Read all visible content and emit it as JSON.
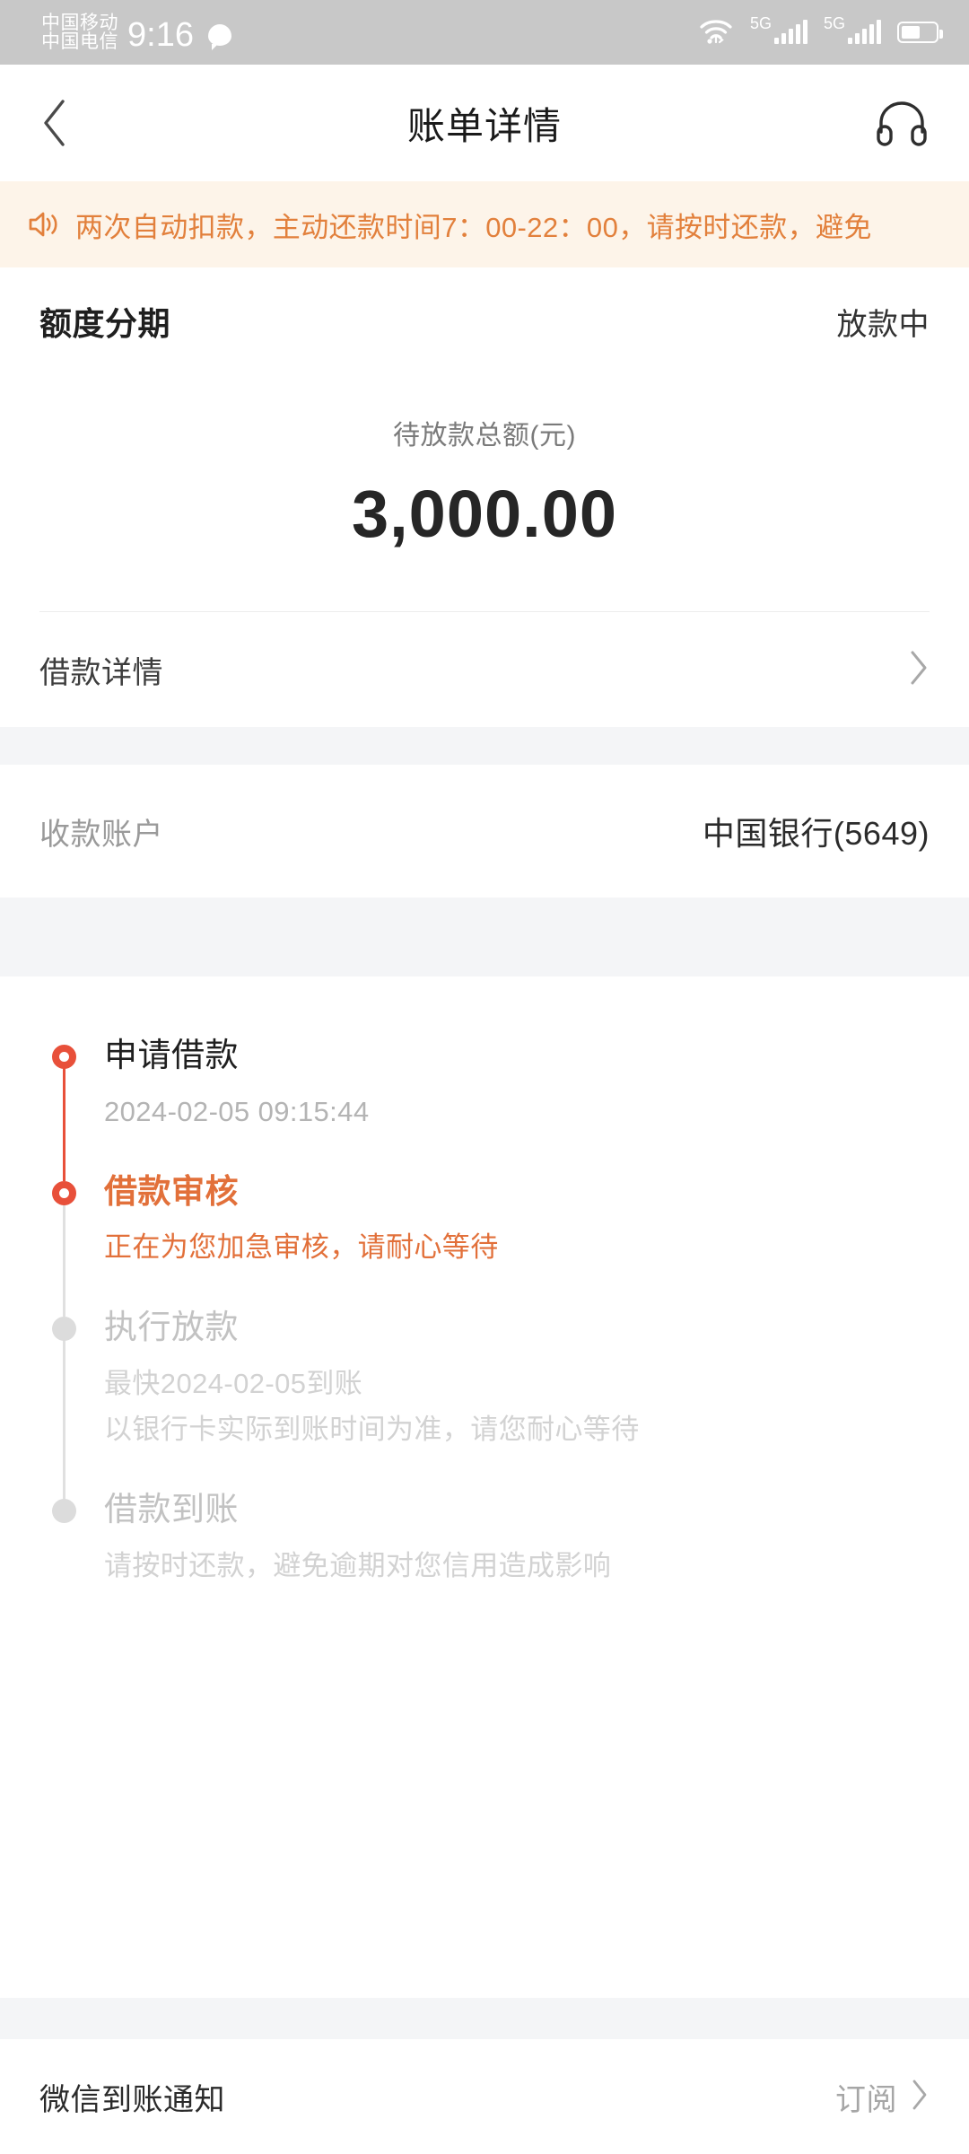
{
  "status_bar": {
    "carrier_primary": "中国移动",
    "carrier_secondary": "中国电信",
    "time": "9:16",
    "message_icon": "message-bubble-icon",
    "wifi_icon": "wifi-icon",
    "network_label_1": "5G",
    "network_label_2": "5G",
    "battery_icon": "battery-icon"
  },
  "navbar": {
    "back_icon": "chevron-left-icon",
    "title": "账单详情",
    "service_icon": "headset-icon"
  },
  "notice": {
    "icon": "speaker-icon",
    "text": "两次自动扣款，主动还款时间7：00-22：00，请按时还款，避免",
    "text_color": "#E2803C",
    "background": "#FDF4E9"
  },
  "summary": {
    "product_name": "额度分期",
    "status": "放款中",
    "amount_label": "待放款总额(元)",
    "amount_value": "3,000.00"
  },
  "detail_link": {
    "label": "借款详情",
    "chevron_icon": "chevron-right-icon"
  },
  "account": {
    "key": "收款账户",
    "value": "中国银行(5649)"
  },
  "timeline": {
    "accent_color": "#E2703A",
    "dot_active_color": "#E8503A",
    "steps": [
      {
        "title": "申请借款",
        "sub1": "2024-02-05 09:15:44",
        "sub2": "",
        "state": "done"
      },
      {
        "title": "借款审核",
        "sub1": "正在为您加急审核，请耐心等待",
        "sub2": "",
        "state": "current"
      },
      {
        "title": "执行放款",
        "sub1": "最快2024-02-05到账",
        "sub2": "以银行卡实际到账时间为准，请您耐心等待",
        "state": "pending"
      },
      {
        "title": "借款到账",
        "sub1": "请按时还款，避免逾期对您信用造成影响",
        "sub2": "",
        "state": "pending"
      }
    ]
  },
  "footer": {
    "label": "微信到账通知",
    "action": "订阅",
    "chevron_icon": "chevron-right-icon"
  }
}
